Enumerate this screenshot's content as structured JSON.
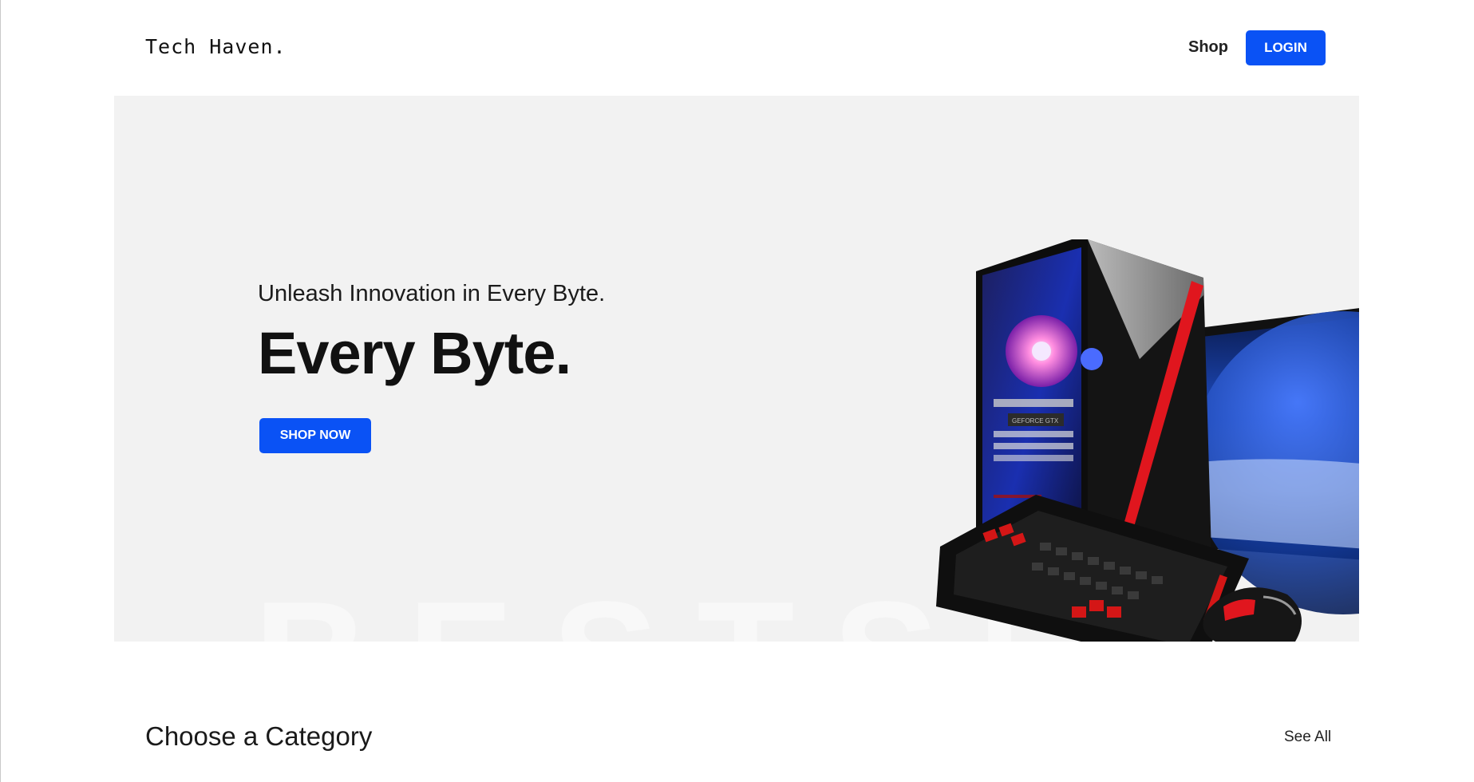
{
  "header": {
    "logo": "Tech Haven.",
    "nav_shop": "Shop",
    "login_label": "LOGIN"
  },
  "hero": {
    "subtitle": "Unleash Innovation in Every Byte.",
    "title": "Every Byte.",
    "button_label": "SHOP NOW",
    "watermark": "BESTSELLER",
    "product_image": "gaming-pc-setup"
  },
  "category_section": {
    "title": "Choose a Category",
    "see_all": "See All"
  },
  "colors": {
    "accent": "#0a52f5",
    "hero_background": "#f2f2f2",
    "text_dark": "#111111"
  }
}
